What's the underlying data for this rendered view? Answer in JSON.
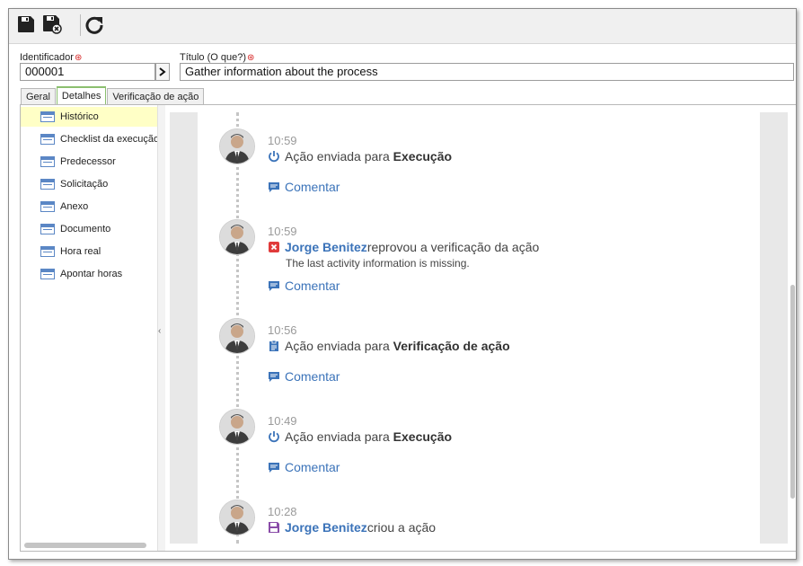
{
  "toolbar": {
    "icons": [
      "save-icon",
      "save-and-close-icon",
      "refresh-icon"
    ]
  },
  "form": {
    "id_label": "Identificador",
    "id_value": "000001",
    "title_label": "Título (O que?)",
    "title_value": "Gather information about the process"
  },
  "tabs": [
    {
      "label": "Geral"
    },
    {
      "label": "Detalhes"
    },
    {
      "label": "Verificação de ação"
    }
  ],
  "sidebar": {
    "items": [
      {
        "label": "Histórico"
      },
      {
        "label": "Checklist da execução"
      },
      {
        "label": "Predecessor"
      },
      {
        "label": "Solicitação"
      },
      {
        "label": "Anexo"
      },
      {
        "label": "Documento"
      },
      {
        "label": "Hora real"
      },
      {
        "label": "Apontar horas"
      }
    ]
  },
  "timeline": {
    "comment_label": "Comentar",
    "entries": [
      {
        "time": "10:59",
        "icon": "power-icon",
        "text": "Ação enviada para ",
        "bold": "Execução"
      },
      {
        "time": "10:59",
        "icon": "reject-icon",
        "user": "Jorge Benitez",
        "text": " reprovou a verificação da ação",
        "note": "The last activity information is missing."
      },
      {
        "time": "10:56",
        "icon": "clipboard-icon",
        "text": "Ação enviada para ",
        "bold": "Verificação de ação"
      },
      {
        "time": "10:49",
        "icon": "power-icon",
        "text": "Ação enviada para ",
        "bold": "Execução"
      },
      {
        "time": "10:28",
        "icon": "save-icon",
        "user": "Jorge Benitez",
        "text": " criou a ação"
      }
    ]
  },
  "colors": {
    "link": "#3b73b9",
    "selected_row": "#ffffc6",
    "required": "#d62020",
    "reject": "#e03a3a",
    "create": "#8a4ca8"
  }
}
